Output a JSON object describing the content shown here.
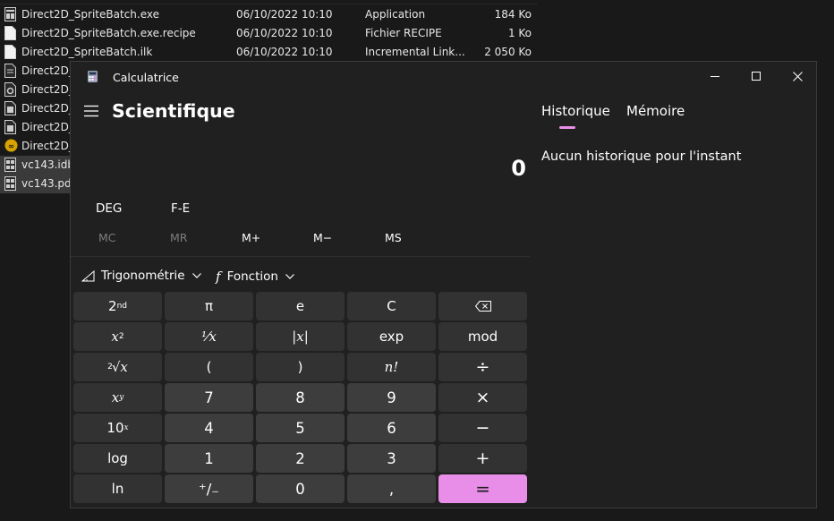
{
  "explorer": {
    "files": [
      {
        "name": "Direct2D_SpriteBatch.exe",
        "date": "06/10/2022 10:10",
        "type": "Application",
        "size": "184 Ko",
        "icon": "exe-icon"
      },
      {
        "name": "Direct2D_SpriteBatch.exe.recipe",
        "date": "06/10/2022 10:10",
        "type": "Fichier RECIPE",
        "size": "1 Ko",
        "icon": "file-icon"
      },
      {
        "name": "Direct2D_SpriteBatch.ilk",
        "date": "06/10/2022 10:10",
        "type": "Incremental Link...",
        "size": "2 050 Ko",
        "icon": "file-icon"
      },
      {
        "name": "Direct2D_",
        "icon": "file-icon"
      },
      {
        "name": "Direct2D_",
        "icon": "settings-file-icon"
      },
      {
        "name": "Direct2D_",
        "icon": "file-icon"
      },
      {
        "name": "Direct2D_",
        "icon": "file-icon"
      },
      {
        "name": "Direct2D_",
        "icon": "vs-solution-icon"
      },
      {
        "name": "vc143.idb",
        "icon": "binary-file-icon"
      },
      {
        "name": "vc143.pdb",
        "icon": "binary-file-icon"
      }
    ]
  },
  "calculator": {
    "title": "Calculatrice",
    "mode": "Scientifique",
    "display": "0",
    "angle": {
      "unit": "DEG",
      "notation": "F-E"
    },
    "memory": {
      "mc": "MC",
      "mr": "MR",
      "mplus": "M+",
      "mminus": "M−",
      "ms": "MS"
    },
    "dropdowns": {
      "trig": "Trigonométrie",
      "func": "Fonction"
    },
    "keys": {
      "second": "2",
      "second_sup": "nd",
      "pi": "π",
      "e": "e",
      "clear": "C",
      "x_sq": "x",
      "x_sq_sup": "2",
      "recip": "⅟x",
      "abs": "|x|",
      "exp": "exp",
      "mod": "mod",
      "sqrt_idx": "2",
      "sqrt": "√x",
      "lparen": "(",
      "rparen": ")",
      "fact": "n!",
      "div": "÷",
      "xpow": "x",
      "xpow_sup": "y",
      "n7": "7",
      "n8": "8",
      "n9": "9",
      "mul": "×",
      "ten": "10",
      "ten_sup": "x",
      "n4": "4",
      "n5": "5",
      "n6": "6",
      "minus": "−",
      "log": "log",
      "n1": "1",
      "n2": "2",
      "n3": "3",
      "plus": "+",
      "ln": "ln",
      "negate": "⁺∕₋",
      "n0": "0",
      "comma": ",",
      "equals": "="
    },
    "history": {
      "tab_history": "Historique",
      "tab_memory": "Mémoire",
      "empty_text": "Aucun historique pour l'instant"
    },
    "colors": {
      "accent": "#e88ee8",
      "background": "#202020"
    }
  }
}
